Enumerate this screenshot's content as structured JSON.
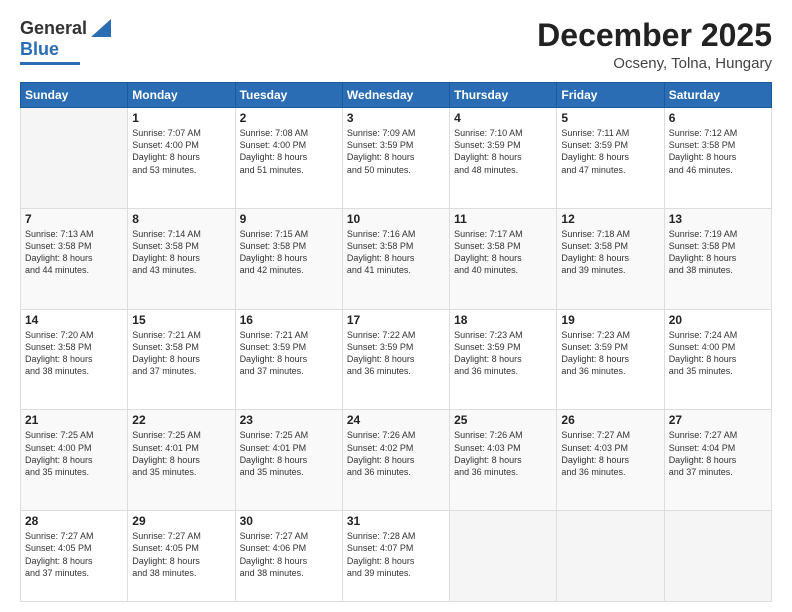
{
  "logo": {
    "general": "General",
    "blue": "Blue"
  },
  "header": {
    "month": "December 2025",
    "location": "Ocseny, Tolna, Hungary"
  },
  "days_of_week": [
    "Sunday",
    "Monday",
    "Tuesday",
    "Wednesday",
    "Thursday",
    "Friday",
    "Saturday"
  ],
  "weeks": [
    [
      {
        "day": "",
        "info": ""
      },
      {
        "day": "1",
        "info": "Sunrise: 7:07 AM\nSunset: 4:00 PM\nDaylight: 8 hours\nand 53 minutes."
      },
      {
        "day": "2",
        "info": "Sunrise: 7:08 AM\nSunset: 4:00 PM\nDaylight: 8 hours\nand 51 minutes."
      },
      {
        "day": "3",
        "info": "Sunrise: 7:09 AM\nSunset: 3:59 PM\nDaylight: 8 hours\nand 50 minutes."
      },
      {
        "day": "4",
        "info": "Sunrise: 7:10 AM\nSunset: 3:59 PM\nDaylight: 8 hours\nand 48 minutes."
      },
      {
        "day": "5",
        "info": "Sunrise: 7:11 AM\nSunset: 3:59 PM\nDaylight: 8 hours\nand 47 minutes."
      },
      {
        "day": "6",
        "info": "Sunrise: 7:12 AM\nSunset: 3:58 PM\nDaylight: 8 hours\nand 46 minutes."
      }
    ],
    [
      {
        "day": "7",
        "info": "Sunrise: 7:13 AM\nSunset: 3:58 PM\nDaylight: 8 hours\nand 44 minutes."
      },
      {
        "day": "8",
        "info": "Sunrise: 7:14 AM\nSunset: 3:58 PM\nDaylight: 8 hours\nand 43 minutes."
      },
      {
        "day": "9",
        "info": "Sunrise: 7:15 AM\nSunset: 3:58 PM\nDaylight: 8 hours\nand 42 minutes."
      },
      {
        "day": "10",
        "info": "Sunrise: 7:16 AM\nSunset: 3:58 PM\nDaylight: 8 hours\nand 41 minutes."
      },
      {
        "day": "11",
        "info": "Sunrise: 7:17 AM\nSunset: 3:58 PM\nDaylight: 8 hours\nand 40 minutes."
      },
      {
        "day": "12",
        "info": "Sunrise: 7:18 AM\nSunset: 3:58 PM\nDaylight: 8 hours\nand 39 minutes."
      },
      {
        "day": "13",
        "info": "Sunrise: 7:19 AM\nSunset: 3:58 PM\nDaylight: 8 hours\nand 38 minutes."
      }
    ],
    [
      {
        "day": "14",
        "info": "Sunrise: 7:20 AM\nSunset: 3:58 PM\nDaylight: 8 hours\nand 38 minutes."
      },
      {
        "day": "15",
        "info": "Sunrise: 7:21 AM\nSunset: 3:58 PM\nDaylight: 8 hours\nand 37 minutes."
      },
      {
        "day": "16",
        "info": "Sunrise: 7:21 AM\nSunset: 3:59 PM\nDaylight: 8 hours\nand 37 minutes."
      },
      {
        "day": "17",
        "info": "Sunrise: 7:22 AM\nSunset: 3:59 PM\nDaylight: 8 hours\nand 36 minutes."
      },
      {
        "day": "18",
        "info": "Sunrise: 7:23 AM\nSunset: 3:59 PM\nDaylight: 8 hours\nand 36 minutes."
      },
      {
        "day": "19",
        "info": "Sunrise: 7:23 AM\nSunset: 3:59 PM\nDaylight: 8 hours\nand 36 minutes."
      },
      {
        "day": "20",
        "info": "Sunrise: 7:24 AM\nSunset: 4:00 PM\nDaylight: 8 hours\nand 35 minutes."
      }
    ],
    [
      {
        "day": "21",
        "info": "Sunrise: 7:25 AM\nSunset: 4:00 PM\nDaylight: 8 hours\nand 35 minutes."
      },
      {
        "day": "22",
        "info": "Sunrise: 7:25 AM\nSunset: 4:01 PM\nDaylight: 8 hours\nand 35 minutes."
      },
      {
        "day": "23",
        "info": "Sunrise: 7:25 AM\nSunset: 4:01 PM\nDaylight: 8 hours\nand 35 minutes."
      },
      {
        "day": "24",
        "info": "Sunrise: 7:26 AM\nSunset: 4:02 PM\nDaylight: 8 hours\nand 36 minutes."
      },
      {
        "day": "25",
        "info": "Sunrise: 7:26 AM\nSunset: 4:03 PM\nDaylight: 8 hours\nand 36 minutes."
      },
      {
        "day": "26",
        "info": "Sunrise: 7:27 AM\nSunset: 4:03 PM\nDaylight: 8 hours\nand 36 minutes."
      },
      {
        "day": "27",
        "info": "Sunrise: 7:27 AM\nSunset: 4:04 PM\nDaylight: 8 hours\nand 37 minutes."
      }
    ],
    [
      {
        "day": "28",
        "info": "Sunrise: 7:27 AM\nSunset: 4:05 PM\nDaylight: 8 hours\nand 37 minutes."
      },
      {
        "day": "29",
        "info": "Sunrise: 7:27 AM\nSunset: 4:05 PM\nDaylight: 8 hours\nand 38 minutes."
      },
      {
        "day": "30",
        "info": "Sunrise: 7:27 AM\nSunset: 4:06 PM\nDaylight: 8 hours\nand 38 minutes."
      },
      {
        "day": "31",
        "info": "Sunrise: 7:28 AM\nSunset: 4:07 PM\nDaylight: 8 hours\nand 39 minutes."
      },
      {
        "day": "",
        "info": ""
      },
      {
        "day": "",
        "info": ""
      },
      {
        "day": "",
        "info": ""
      }
    ]
  ]
}
